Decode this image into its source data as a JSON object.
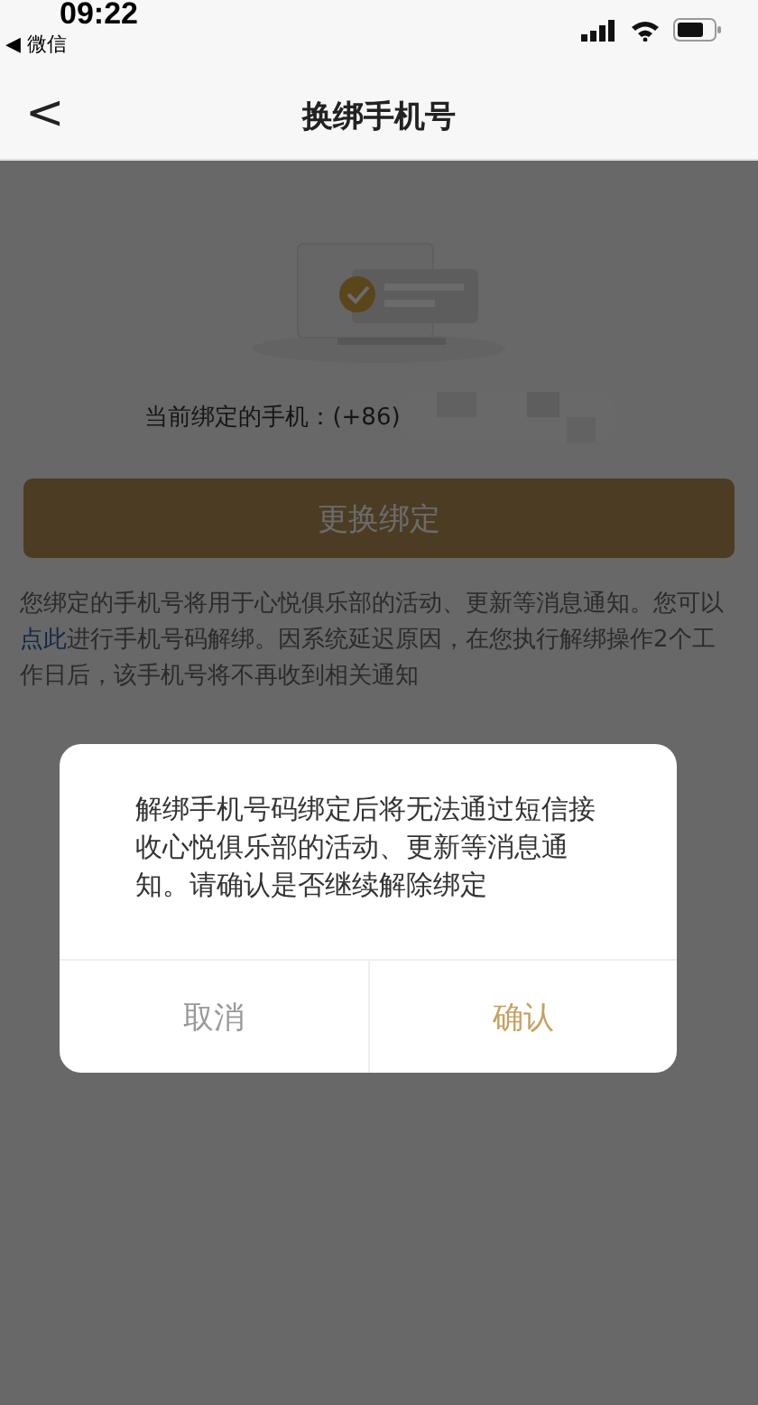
{
  "status_bar": {
    "time": "09:22",
    "back_app": "◀ 微信"
  },
  "nav_bar": {
    "back": "<",
    "title": "换绑手机号"
  },
  "current_phone": {
    "label": "当前绑定的手机：(+86)"
  },
  "change_button": {
    "label": "更换绑定"
  },
  "notice": {
    "before": "您绑定的手机号将用于心悦俱乐部的活动、更新等消息通知。您可以",
    "link": "点此",
    "after": "进行手机号码解绑。因系统延迟原因，在您执行解绑操作2个工作日后，该手机号将不再收到相关通知"
  },
  "dialog": {
    "message": "解绑手机号码绑定后将无法通过短信接收心悦俱乐部的活动、更新等消息通知。请确认是否继续解除绑定",
    "buttons": [
      {
        "label": "取消",
        "kind": "cancel"
      },
      {
        "label": "确认",
        "kind": "confirm"
      }
    ]
  }
}
